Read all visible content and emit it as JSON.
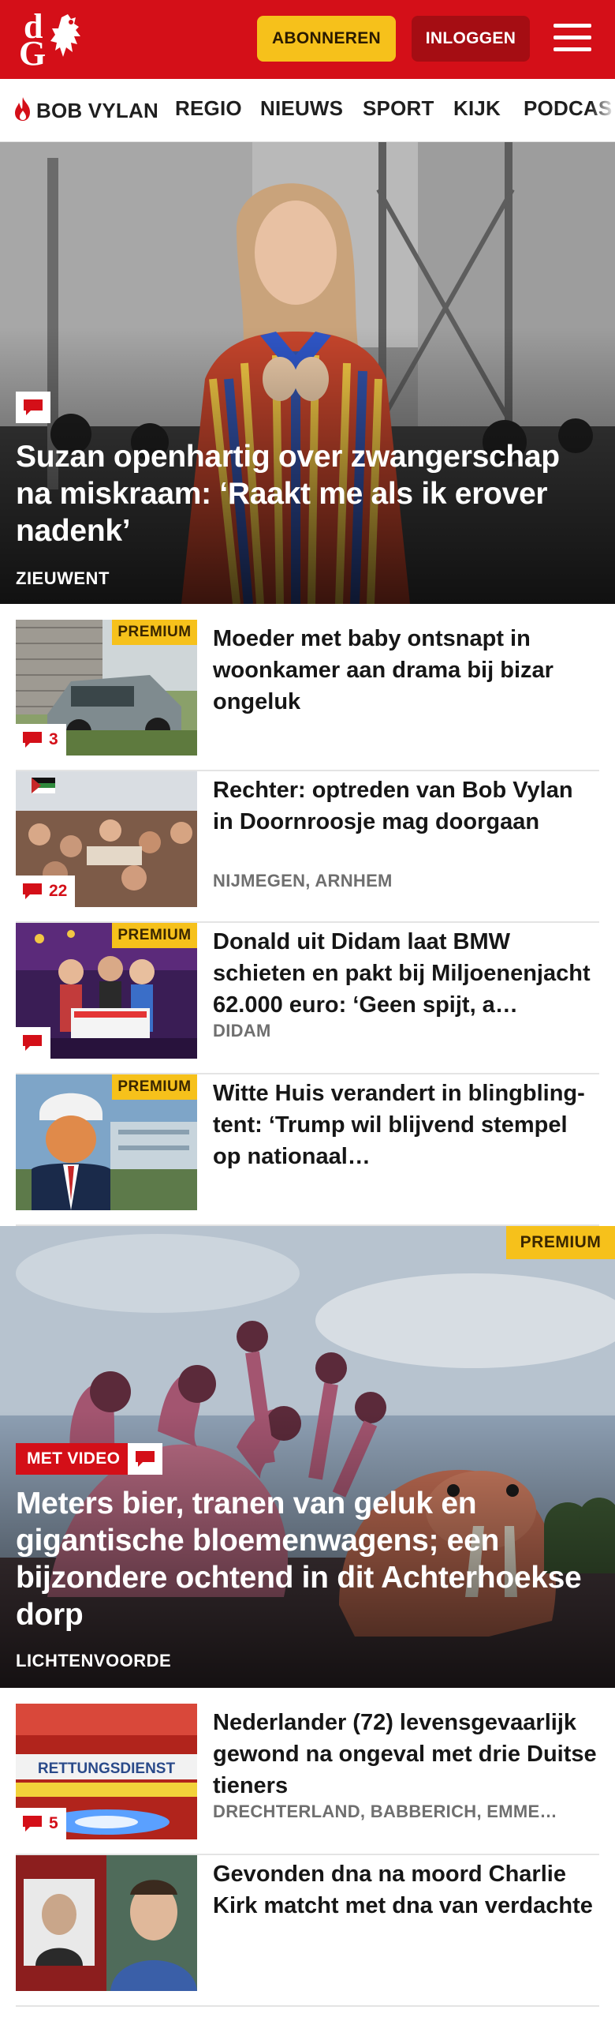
{
  "header": {
    "logo_text": "dG",
    "subscribe_label": "ABONNEREN",
    "login_label": "INLOGGEN",
    "menu_icon": "hamburger-icon"
  },
  "nav": {
    "items": [
      {
        "label": "BOB VYLAN",
        "icon": "flame-icon"
      },
      {
        "label": "REGIO"
      },
      {
        "label": "NIEUWS"
      },
      {
        "label": "SPORT"
      },
      {
        "label": "KIJK"
      },
      {
        "label": "PODCAS"
      }
    ]
  },
  "hero1": {
    "title": "Suzan openhartig over zwangerschap na miskraam: ‘Raakt me als ik erover nadenk’",
    "location": "ZIEUWENT",
    "icon": "comment-icon"
  },
  "articles": [
    {
      "title": "Moeder met baby ontsnapt in woonkamer aan drama bij bizar ongeluk",
      "premium": "PREMIUM",
      "comments": "3",
      "location": ""
    },
    {
      "title": "Rechter: optreden van Bob Vylan in Doornroosje mag doorgaan",
      "premium": "",
      "comments": "22",
      "location": "NIJMEGEN, ARNHEM"
    },
    {
      "title": "Donald uit Didam laat BMW schieten en pakt bij Miljoenen­jacht 62.000 euro: ‘Geen spijt, a…",
      "premium": "PREMIUM",
      "comments": "",
      "location": "DIDAM"
    },
    {
      "title": "Witte Huis verandert in blingbling-tent: ‘Trump wil blijvend stempel op nationaal…",
      "premium": "PREMIUM",
      "comments": "",
      "location": ""
    }
  ],
  "hero2": {
    "premium": "PREMIUM",
    "video_label": "MET VIDEO",
    "title": "Meters bier, tranen van geluk en gigantische bloemenwagens; een bijzondere ochtend in dit Achterhoek­se dorp",
    "location": "LICHTENVOORDE"
  },
  "articles2": [
    {
      "title": "Nederlander (72) levensgevaar­lijk gewond na ongeval met drie Duitse tieners",
      "comments": "5",
      "location": "DRECHTERLAND, BABBERICH, EMME…",
      "thumb_text": "RETTUNGSDIENST"
    },
    {
      "title": "Gevonden dna na moord Charlie Kirk matcht met dna van verdachte",
      "comments": "",
      "location": ""
    }
  ],
  "colors": {
    "brand_red": "#d40f18",
    "premium_yellow": "#f6c11b",
    "login_dark_red": "#a50d13"
  }
}
